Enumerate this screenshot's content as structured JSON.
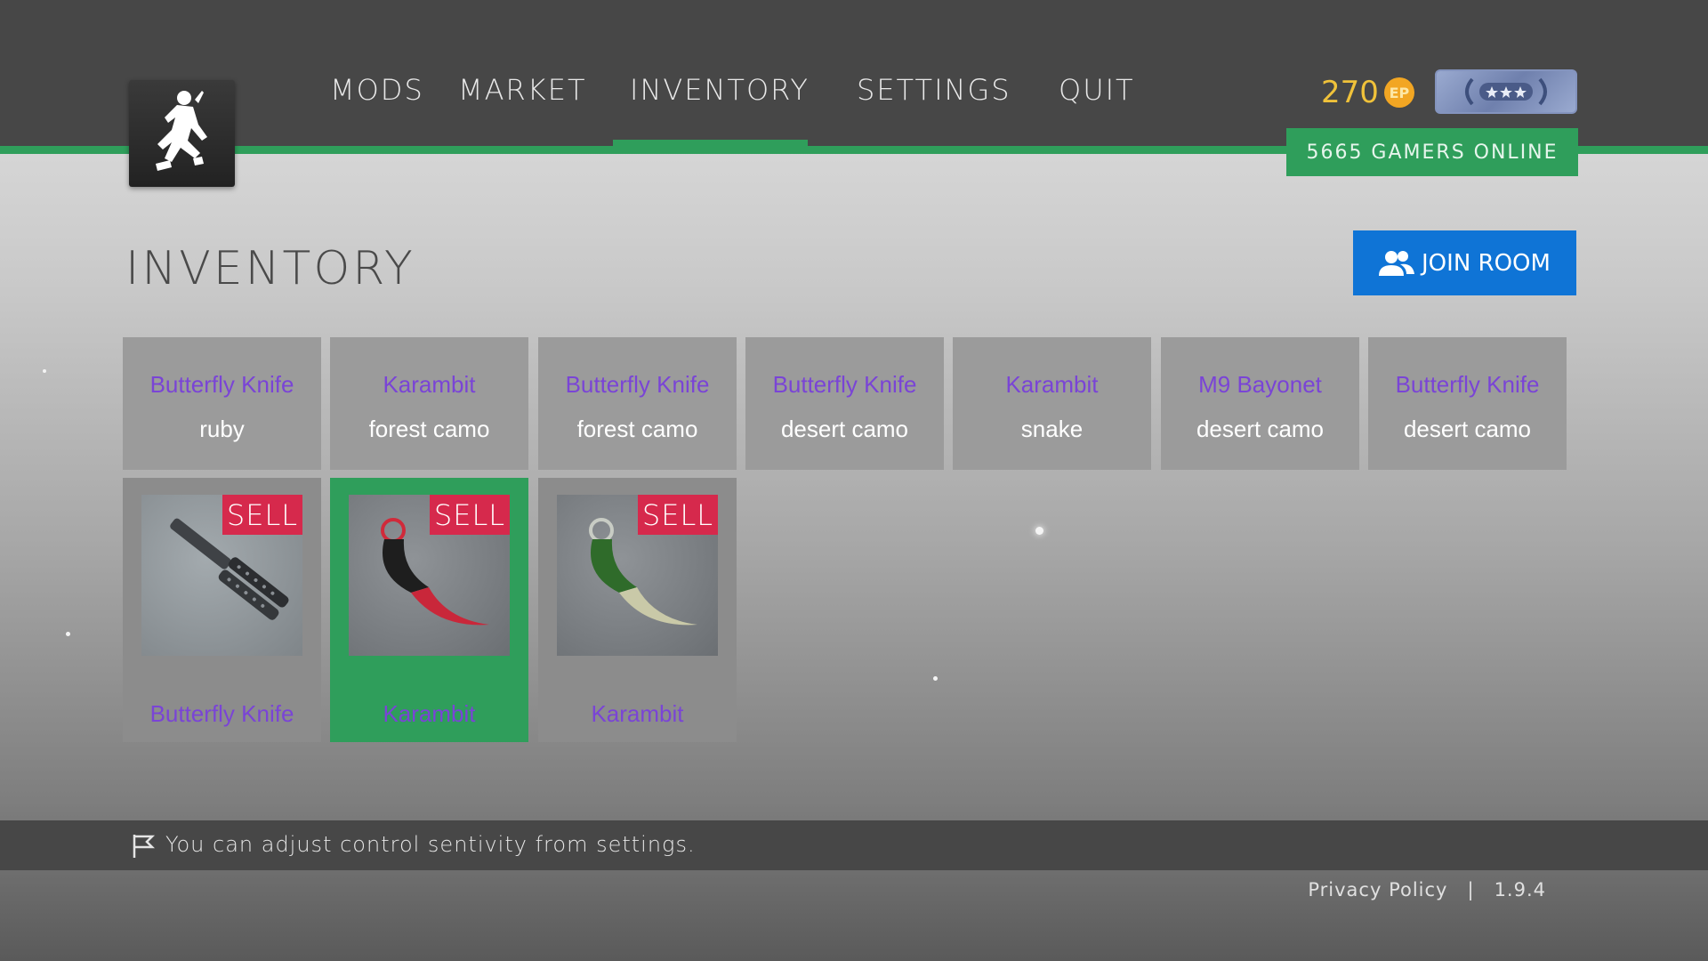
{
  "nav": {
    "items": [
      {
        "label": "MODS"
      },
      {
        "label": "MARKET"
      },
      {
        "label": "INVENTORY"
      },
      {
        "label": "SETTINGS"
      },
      {
        "label": "QUIT"
      }
    ],
    "active": "INVENTORY"
  },
  "currency": {
    "amount": "270",
    "icon_label": "EP",
    "icon": "coin-icon"
  },
  "rank": {
    "icon": "rank-badge-icon"
  },
  "online": {
    "text": "5665 GAMERS ONLINE"
  },
  "page": {
    "title": "INVENTORY"
  },
  "join_button": {
    "label": "JOIN ROOM",
    "icon": "users-icon"
  },
  "market_items": [
    {
      "name": "Butterfly Knife",
      "skin": "ruby"
    },
    {
      "name": "Karambit",
      "skin": "forest camo"
    },
    {
      "name": "Butterfly Knife",
      "skin": "forest camo"
    },
    {
      "name": "Butterfly Knife",
      "skin": "desert camo"
    },
    {
      "name": "Karambit",
      "skin": "snake"
    },
    {
      "name": "M9 Bayonet",
      "skin": "desert camo"
    },
    {
      "name": "Butterfly Knife",
      "skin": "desert camo"
    }
  ],
  "owned_items": [
    {
      "name": "Butterfly Knife",
      "sell_label": "SELL",
      "selected": false
    },
    {
      "name": "Karambit",
      "sell_label": "SELL",
      "selected": true
    },
    {
      "name": "Karambit",
      "sell_label": "SELL",
      "selected": false
    }
  ],
  "tip": {
    "text": "You can adjust control sentivity from settings.",
    "icon": "flag-icon"
  },
  "footer": {
    "privacy": "Privacy Policy",
    "separator": "|",
    "version": "1.9.4"
  },
  "colors": {
    "accent_green": "#2f9e5b",
    "join_blue": "#0f74d6",
    "sell_red": "#d6294c",
    "item_purple": "#7a44d6",
    "coin_gold": "#f0c23a"
  }
}
